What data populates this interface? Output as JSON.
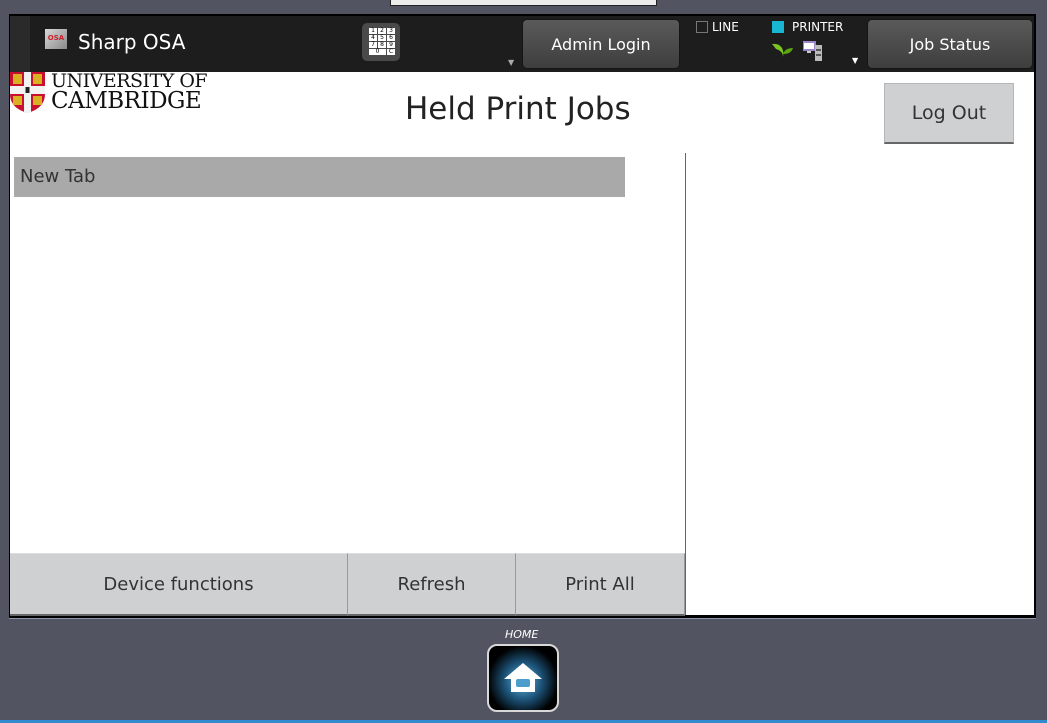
{
  "header": {
    "app_title": "Sharp OSA",
    "app_icon_text": "OSA",
    "keypad_keys": [
      "1",
      "2",
      "3",
      "4",
      "5",
      "6",
      "7",
      "8",
      "9",
      "",
      "0",
      "C"
    ],
    "admin_login_label": "Admin Login",
    "job_status_label": "Job Status",
    "status": {
      "line_label": "LINE",
      "line_active": false,
      "printer_label": "PRINTER",
      "printer_active": true,
      "printer_indicator_color": "#19b6d3"
    }
  },
  "main": {
    "logo_line1": "UNIVERSITY OF",
    "logo_line2": "CAMBRIDGE",
    "page_title": "Held Print Jobs",
    "logout_label": "Log Out",
    "tabs": [
      {
        "label": "New Tab"
      }
    ],
    "actions": {
      "device_functions": "Device functions",
      "refresh": "Refresh",
      "print_all": "Print All"
    }
  },
  "footer": {
    "home_label": "HOME"
  }
}
